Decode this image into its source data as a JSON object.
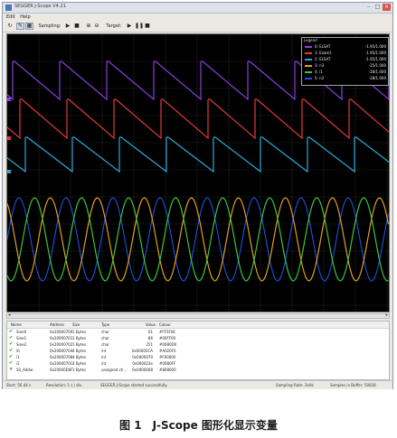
{
  "window": {
    "title": "SEGGER J-Scope V4.21"
  },
  "menu": [
    "Edit",
    "Help"
  ],
  "toolbar": {
    "sampling_label": "Sampling:",
    "target_label": "Target:"
  },
  "legend": {
    "title": "Legend",
    "rows": [
      {
        "name": "0: ELSAT",
        "value": "-1.95/1.000",
        "color": "#8a3ee0"
      },
      {
        "name": "1: Exam1",
        "value": "-1.95/1.000",
        "color": "#e03a3a"
      },
      {
        "name": "2: ELSAT",
        "value": "-1.95/1.000",
        "color": "#2aa8d8"
      },
      {
        "name": "3: n3",
        "value": "-25/1.000",
        "color": "#e0a020"
      },
      {
        "name": "4: i1",
        "value": "-28/1.000",
        "color": "#3dc63d"
      },
      {
        "name": "5: n2",
        "value": "-28/1.000",
        "color": "#2050e0"
      }
    ]
  },
  "table": {
    "headers": [
      "Name",
      "Address",
      "Size",
      "Type",
      "Value",
      "Colour"
    ],
    "rows": [
      {
        "name": "Sine0",
        "address": "0x20000700",
        "size": "1 Bytes",
        "type": "char",
        "value": "61",
        "colour": "#FF5F0E"
      },
      {
        "name": "Sine1",
        "address": "0x20000701",
        "size": "1 Bytes",
        "type": "char",
        "value": "86",
        "colour": "#00FF00"
      },
      {
        "name": "Sine2",
        "address": "0x20000702",
        "size": "1 Bytes",
        "type": "char",
        "value": "251",
        "colour": "#0080D0"
      },
      {
        "name": "i0",
        "address": "0x20000704",
        "size": "4 Bytes",
        "type": "int",
        "value": "0x00005CA",
        "colour": "#A020F0"
      },
      {
        "name": "i1",
        "address": "0x20000708",
        "size": "4 Bytes",
        "type": "int",
        "value": "0x0000070",
        "colour": "#F00000"
      },
      {
        "name": "i2",
        "address": "0x2000070C",
        "size": "4 Bytes",
        "type": "int",
        "value": "0x000022e",
        "colour": "#00B0FF"
      },
      {
        "name": "SS_Adder",
        "address": "0x20000D0F",
        "size": "1 Bytes",
        "type": "unsigned ch...",
        "value": "0x0000008",
        "colour": "#808000"
      }
    ]
  },
  "status": {
    "left": "Start: 56.44 s",
    "resolution": "Resolution: 1 s / div",
    "message": "SEGGER J-Scope started successfully.",
    "rate": "Sampling Rate: 1kHz",
    "samples": "Samples in Buffer: 50028"
  },
  "caption": "图 1　J-Scope 图形化显示变量"
}
